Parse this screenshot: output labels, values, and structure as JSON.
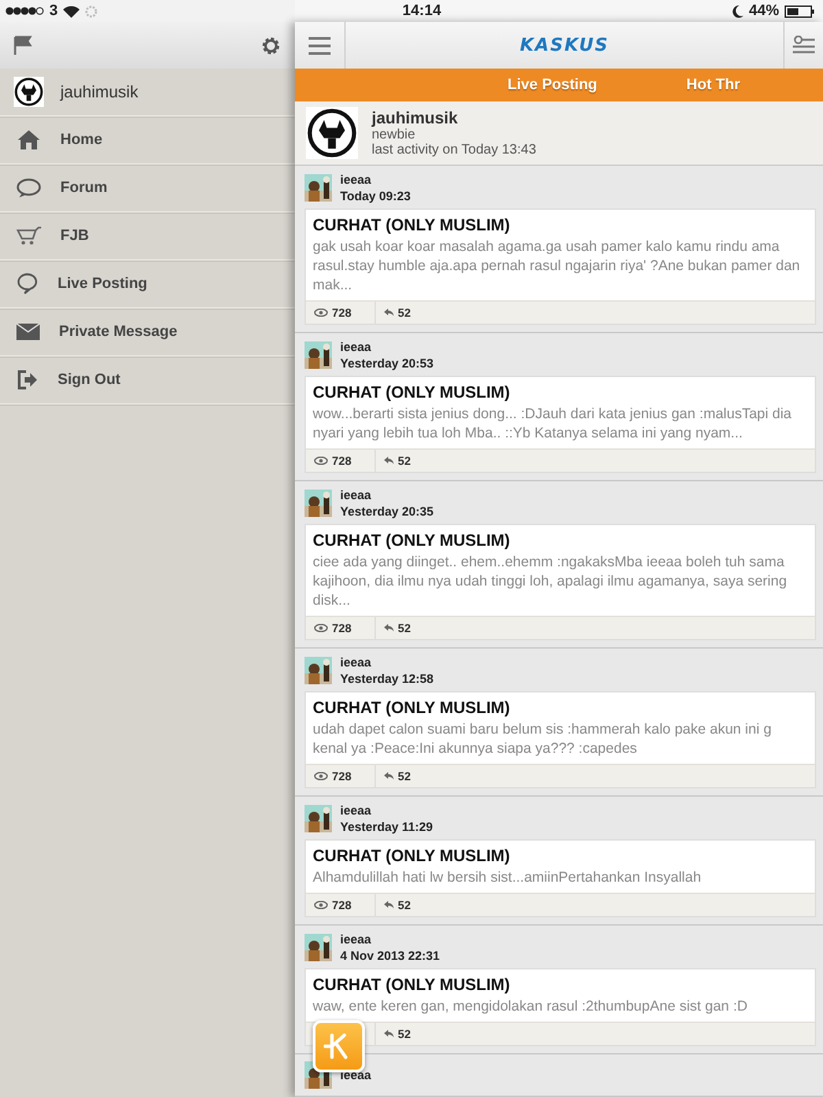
{
  "status_bar": {
    "carrier": "3",
    "time": "14:14",
    "battery": "44%"
  },
  "sidebar": {
    "user": "jauhimusik",
    "items": [
      {
        "label": "Home",
        "kind": "home"
      },
      {
        "label": "Forum",
        "kind": "forum"
      },
      {
        "label": "FJB",
        "kind": "shop"
      },
      {
        "label": "Live Posting",
        "kind": "live"
      },
      {
        "label": "Private Message",
        "kind": "message"
      },
      {
        "label": "Sign Out",
        "kind": "signout"
      }
    ]
  },
  "navbar": {
    "logo": "KASKUS"
  },
  "tabs": [
    {
      "label": "Live Posting"
    },
    {
      "label": "Hot Thr"
    }
  ],
  "profile": {
    "name": "jauhimusik",
    "rank": "newbie",
    "activity": "last activity on Today 13:43"
  },
  "posts": [
    {
      "user": "ieeaa",
      "time": "Today 09:23",
      "title": "CURHAT (ONLY MUSLIM)",
      "excerpt": "gak usah koar koar masalah agama.ga usah pamer kalo kamu rindu ama rasul.stay humble aja.apa pernah rasul ngajarin riya' ?Ane bukan pamer dan mak...",
      "views": "728",
      "replies": "52"
    },
    {
      "user": "ieeaa",
      "time": "Yesterday 20:53",
      "title": "CURHAT (ONLY MUSLIM)",
      "excerpt": "wow...berarti sista jenius dong... :DJauh dari kata jenius gan :malusTapi dia nyari yang lebih tua loh Mba.. ::Yb Katanya selama ini yang nyam...",
      "views": "728",
      "replies": "52"
    },
    {
      "user": "ieeaa",
      "time": "Yesterday 20:35",
      "title": "CURHAT (ONLY MUSLIM)",
      "excerpt": "ciee ada yang diinget.. ehem..ehemm :ngakaksMba ieeaa boleh tuh sama kajihoon, dia ilmu nya udah tinggi loh, apalagi ilmu agamanya, saya sering disk...",
      "views": "728",
      "replies": "52"
    },
    {
      "user": "ieeaa",
      "time": "Yesterday 12:58",
      "title": "CURHAT (ONLY MUSLIM)",
      "excerpt": "udah dapet calon suami baru belum sis :hammerah kalo pake akun ini g kenal ya :Peace:Ini akunnya siapa ya??? :capedes",
      "views": "728",
      "replies": "52"
    },
    {
      "user": "ieeaa",
      "time": "Yesterday 11:29",
      "title": "CURHAT (ONLY MUSLIM)",
      "excerpt": "Alhamdulillah hati lw bersih sist...amiinPertahankan Insyallah",
      "views": "728",
      "replies": "52"
    },
    {
      "user": "ieeaa",
      "time": "4 Nov 2013 22:31",
      "title": "CURHAT (ONLY MUSLIM)",
      "excerpt": "waw, ente keren gan, mengidolakan rasul :2thumbupAne sist gan :D",
      "replies": "52"
    },
    {
      "user": "ieeaa"
    }
  ]
}
